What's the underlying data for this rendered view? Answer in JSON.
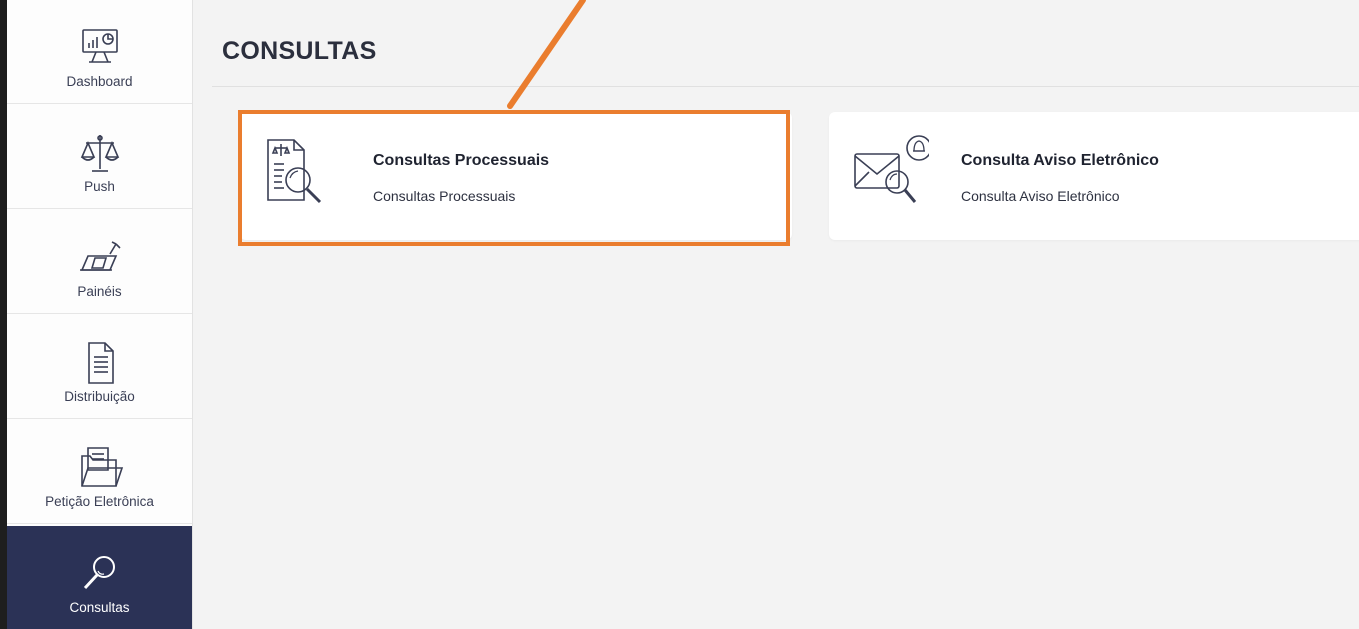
{
  "sidebar": {
    "items": [
      {
        "label": "Dashboard",
        "icon": "dashboard-monitor-icon",
        "active": false
      },
      {
        "label": "Push",
        "icon": "scales-icon",
        "active": false
      },
      {
        "label": "Painéis",
        "icon": "panels-icon",
        "active": false
      },
      {
        "label": "Distribuição",
        "icon": "document-icon",
        "active": false
      },
      {
        "label": "Petição Eletrônica",
        "icon": "folder-document-icon",
        "active": false
      },
      {
        "label": "Consultas",
        "icon": "magnifier-icon",
        "active": true
      }
    ]
  },
  "page": {
    "title": "CONSULTAS"
  },
  "cards": [
    {
      "title": "Consultas Processuais",
      "subtitle": "Consultas Processuais",
      "icon": "legal-document-search-icon"
    },
    {
      "title": "Consulta Aviso Eletrônico",
      "subtitle": "Consulta Aviso Eletrônico",
      "icon": "envelope-bell-search-icon"
    }
  ],
  "colors": {
    "sidebar_active_bg": "#2b3256",
    "highlight": "#ea7d2e",
    "icon_stroke": "#3a3f55",
    "background": "#f3f3f3"
  }
}
